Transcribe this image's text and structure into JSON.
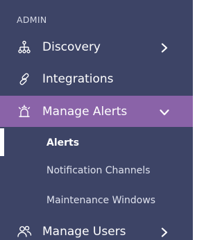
{
  "sidebar": {
    "section_label": "ADMIN",
    "items": [
      {
        "label": "Discovery",
        "icon": "network-tree-icon",
        "expandable": true
      },
      {
        "label": "Integrations",
        "icon": "link-icon",
        "expandable": false
      },
      {
        "label": "Manage Alerts",
        "icon": "alarm-icon",
        "expandable": true,
        "expanded": true,
        "active": true
      },
      {
        "label": "Manage Users",
        "icon": "users-icon",
        "expandable": true
      }
    ],
    "alerts_submenu": [
      {
        "label": "Alerts",
        "selected": true
      },
      {
        "label": "Notification Channels",
        "selected": false
      },
      {
        "label": "Maintenance Windows",
        "selected": false
      }
    ]
  },
  "colors": {
    "sidebar_bg": "#3d4466",
    "active_bg": "#8a63a8",
    "text": "#ffffff"
  }
}
